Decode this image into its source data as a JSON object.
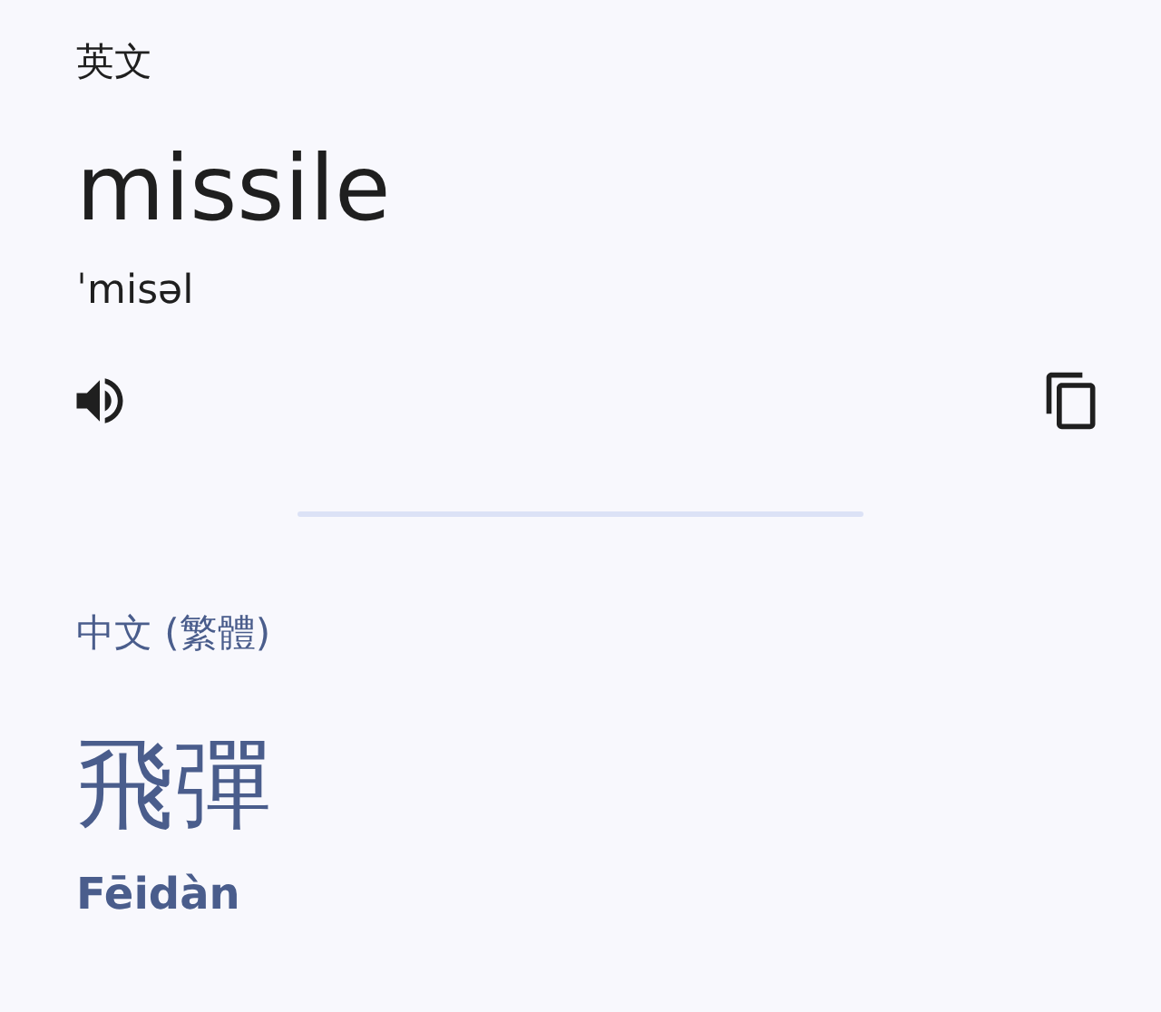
{
  "source": {
    "language": "英文",
    "text": "missile",
    "phonetic": "ˈmisəl"
  },
  "target": {
    "language": "中文 (繁體)",
    "text": "飛彈",
    "romanization": "Fēidàn"
  }
}
